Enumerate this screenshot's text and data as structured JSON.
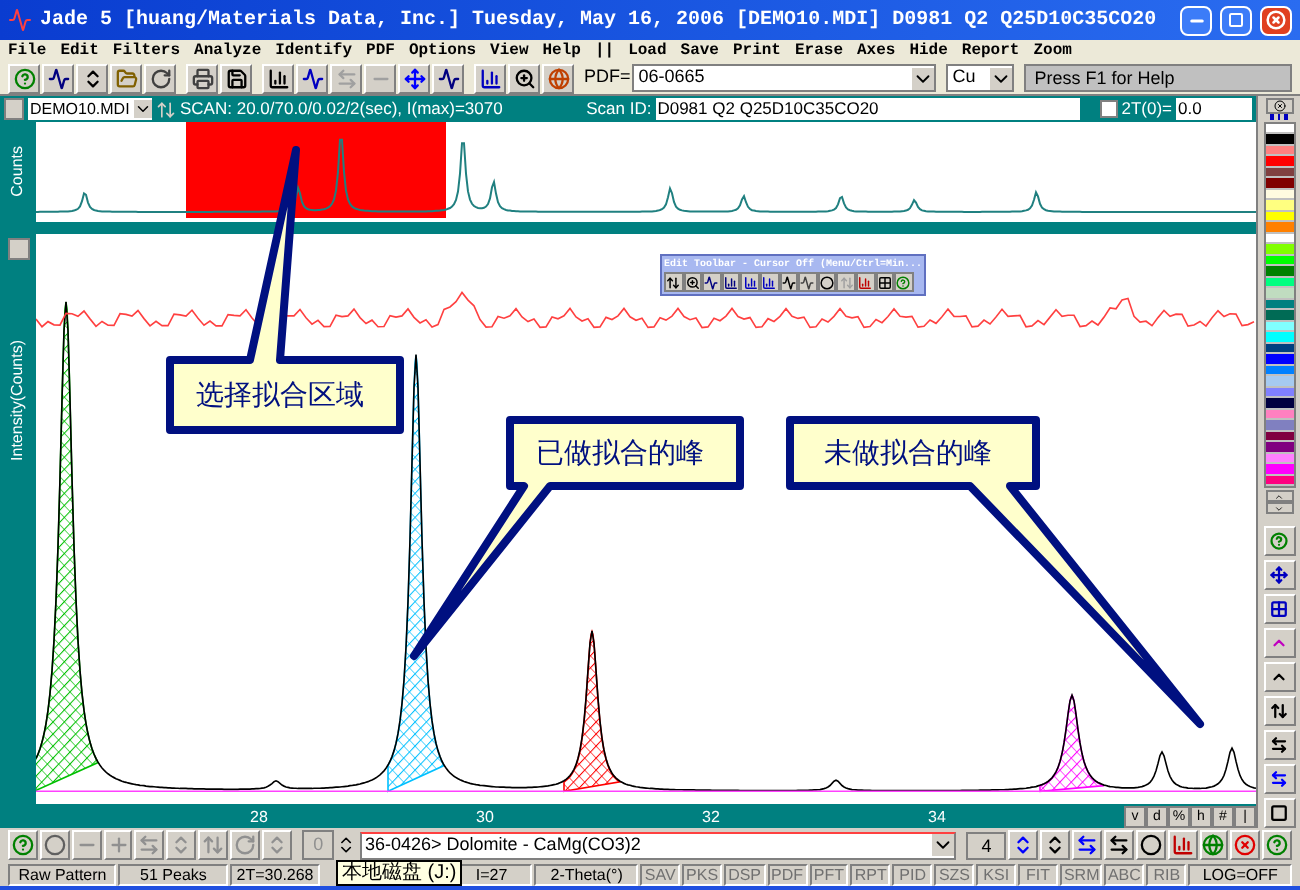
{
  "window": {
    "title": "Jade 5 [huang/Materials Data, Inc.] Tuesday, May 16, 2006 [DEMO10.MDI] D0981 Q2 Q25D10C35CO20"
  },
  "menu": [
    "File",
    "Edit",
    "Filters",
    "Analyze",
    "Identify",
    "PDF",
    "Options",
    "View",
    "Help",
    "||",
    "Load",
    "Save",
    "Print",
    "Erase",
    "Axes",
    "Hide",
    "Report",
    "Zoom"
  ],
  "toolbar": {
    "pdf_label": "PDF=",
    "pdf_value": "06-0665",
    "radiation": "Cu",
    "hint": "Press F1 for Help"
  },
  "scan_bar": {
    "file": "DEMO10.MDI",
    "scan_info": "SCAN: 20.0/70.0/0.02/2(sec), I(max)=3070",
    "scan_id_label": "Scan ID:",
    "scan_id": "D0981 Q2 Q25D10C35CO20",
    "two_theta_label": "2T(0)=",
    "two_theta_checked": false,
    "two_theta_value": "0.0"
  },
  "overview": {
    "axis_label": "Counts"
  },
  "main_plot": {
    "axis_label": "Intensity(Counts)",
    "x_ticks": [
      "28",
      "30",
      "32",
      "34"
    ]
  },
  "edit_toolbar": {
    "title": "Edit Toolbar - Cursor Off (Menu/Ctrl=Min..."
  },
  "callouts": [
    {
      "text": "选择拟合区域"
    },
    {
      "text": "已做拟合的峰"
    },
    {
      "text": "未做拟合的峰"
    }
  ],
  "palette": [
    {
      "color": "#ffffff"
    },
    {
      "color": "#000000"
    },
    {
      "color": "#ff8080"
    },
    {
      "color": "#ff0000"
    },
    {
      "color": "#804040"
    },
    {
      "color": "#800000"
    },
    {
      "color": "#fffbe0"
    },
    {
      "color": "#ffff80"
    },
    {
      "color": "#ffff00"
    },
    {
      "color": "#ff8000"
    },
    {
      "color": "#ffffff"
    },
    {
      "color": "#80ff00"
    },
    {
      "color": "#00ff00"
    },
    {
      "color": "#008000"
    },
    {
      "color": "#00ff80"
    },
    {
      "color": "#c0dcc0"
    },
    {
      "color": "#008080"
    },
    {
      "color": "#006b55"
    },
    {
      "color": "#80ffff"
    },
    {
      "color": "#00ffff"
    },
    {
      "color": "#004080"
    },
    {
      "color": "#0000ff"
    },
    {
      "color": "#0080ff"
    },
    {
      "color": "#a6caf0"
    },
    {
      "color": "#8080ff"
    },
    {
      "color": "#000040"
    },
    {
      "color": "#ff80c0"
    },
    {
      "color": "#8080c0"
    },
    {
      "color": "#800040"
    },
    {
      "color": "#800080"
    },
    {
      "color": "#ff80ff"
    },
    {
      "color": "#ff00ff"
    },
    {
      "color": "#ff0080"
    }
  ],
  "axis_buttons": [
    "v",
    "d",
    "%",
    "h",
    "#",
    "|"
  ],
  "bottom_toolbar": {
    "counter": "0",
    "phase": "36-0426> Dolomite - CaMg(CO3)2",
    "number": "4"
  },
  "status_bar": [
    {
      "text": "Raw Pattern",
      "disabled": false
    },
    {
      "text": "51 Peaks",
      "disabled": false
    },
    {
      "text": "2T=30.268",
      "disabled": false
    },
    {
      "text": "I=27",
      "disabled": false
    },
    {
      "text": "2-Theta(°)",
      "disabled": false
    },
    {
      "text": "SAV",
      "disabled": true
    },
    {
      "text": "PKS",
      "disabled": true
    },
    {
      "text": "DSP",
      "disabled": true
    },
    {
      "text": "PDF",
      "disabled": true
    },
    {
      "text": "PFT",
      "disabled": true
    },
    {
      "text": "RPT",
      "disabled": true
    },
    {
      "text": "PID",
      "disabled": true
    },
    {
      "text": "SZS",
      "disabled": true
    },
    {
      "text": "KSI",
      "disabled": true
    },
    {
      "text": "FIT",
      "disabled": true
    },
    {
      "text": "SRM",
      "disabled": true
    },
    {
      "text": "ABC",
      "disabled": true
    },
    {
      "text": "RIB",
      "disabled": true
    },
    {
      "text": "LOG=OFF",
      "disabled": false
    }
  ],
  "tooltip": {
    "text": "本地磁盘 (J:)"
  }
}
